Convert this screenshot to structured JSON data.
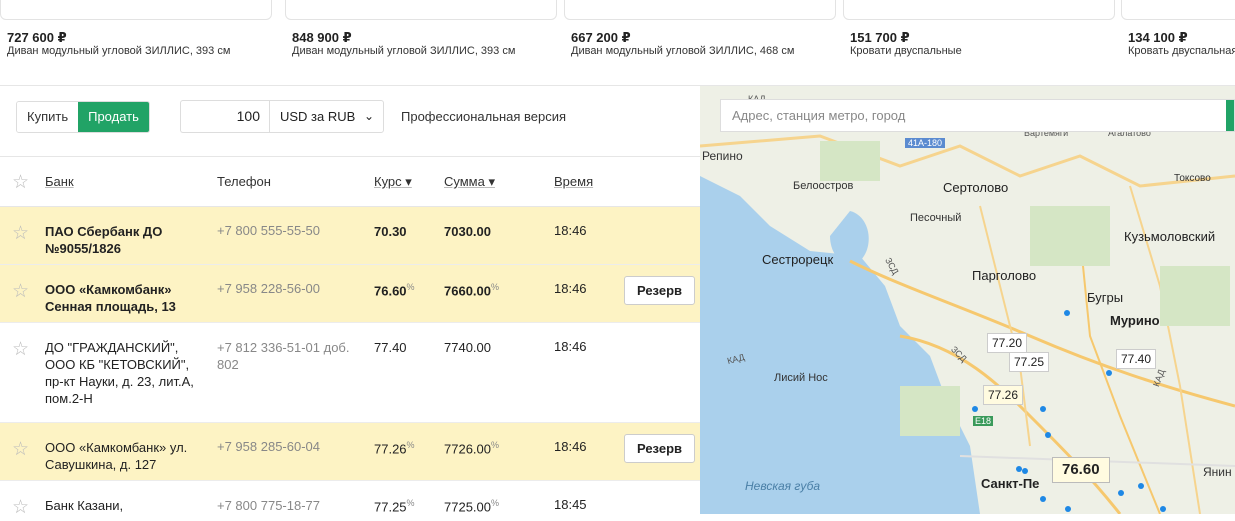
{
  "products": [
    {
      "price": "727 600 ₽",
      "name": "Диван модульный угловой ЗИЛЛИС, 393 см"
    },
    {
      "price": "848 900 ₽",
      "name": "Диван модульный угловой ЗИЛЛИС, 393 см"
    },
    {
      "price": "667 200 ₽",
      "name": "Диван модульный угловой ЗИЛЛИС, 468 см"
    },
    {
      "price": "151 700 ₽",
      "name": "Кровати двуспальные"
    },
    {
      "price": "134 100 ₽",
      "name": "Кровать двуспальная"
    }
  ],
  "controls": {
    "buy": "Купить",
    "sell": "Продать",
    "amount": "100",
    "currency": "USD за RUB",
    "pro": "Профессиональная версия"
  },
  "table": {
    "headers": {
      "bank": "Банк",
      "phone": "Телефон",
      "rate": "Курс",
      "sum": "Сумма",
      "time": "Время"
    },
    "rows": [
      {
        "bank": "ПАО Сбербанк ДО №9055/1826",
        "phone": "+7 800 555-55-50",
        "rate": "70.30",
        "sum": "7030.00",
        "time": "18:46"
      },
      {
        "bank": "ООО «Камкомбанк» Сенная площадь, 13",
        "phone": "+7 958 228-56-00",
        "rate": "76.60",
        "sum": "7660.00",
        "time": "18:46",
        "reserve": "Резерв"
      },
      {
        "bank": "ДО \"ГРАЖДАНСКИЙ\", ООО КБ \"КЕТОВСКИЙ\", пр-кт Науки, д. 23, лит.А, пом.2-Н",
        "phone": "+7 812 336-51-01 доб. 802",
        "rate": "77.40",
        "sum": "7740.00",
        "time": "18:46"
      },
      {
        "bank": "ООО «Камкомбанк» ул. Савушкина, д. 127",
        "phone": "+7 958 285-60-04",
        "rate": "77.26",
        "sum": "7726.00",
        "time": "18:46",
        "reserve": "Резерв"
      },
      {
        "bank": "Банк Казани,",
        "phone": "+7 800 775-18-77",
        "rate": "77.25",
        "sum": "7725.00",
        "time": "18:45"
      }
    ],
    "pct": "%"
  },
  "map": {
    "search_placeholder": "Адрес, станция метро, город",
    "labels": [
      "Репино",
      "Белоостров",
      "Сертолово",
      "Песочный",
      "Сестрорецк",
      "Парголово",
      "Бугры",
      "Мурино",
      "Кузьмоловский",
      "Токсово",
      "Лисий Нос",
      "Невская губа",
      "Санкт-Пе",
      "Янин",
      "41А-180",
      "ЗСД",
      "КАД",
      "Е18",
      "КАД",
      "ЗСД",
      "КАД",
      "Вартемяги",
      "Агалатово"
    ],
    "pins": [
      "77.20",
      "77.25",
      "77.40",
      "77.26",
      "76.60"
    ]
  }
}
